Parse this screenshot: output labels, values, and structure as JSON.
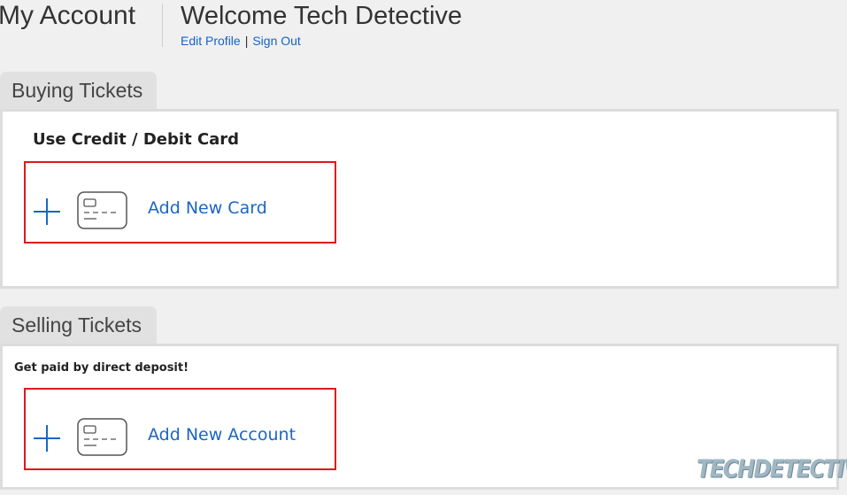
{
  "header": {
    "account_title": "My Account",
    "welcome_title": "Welcome Tech Detective",
    "edit_profile_link": "Edit Profile",
    "separator": "|",
    "sign_out_link": "Sign Out"
  },
  "buying": {
    "tab_label": "Buying Tickets",
    "heading": "Use Credit / Debit Card",
    "add_label": "Add New Card"
  },
  "selling": {
    "tab_label": "Selling Tickets",
    "heading": "Get paid by direct deposit!",
    "add_label": "Add New Account"
  },
  "icons": {
    "add": "plus-icon",
    "card": "credit-card-icon"
  },
  "colors": {
    "link": "#1464c8",
    "highlight_border": "#e01818",
    "action_text": "#1a66c4",
    "background": "#f0f0f0"
  },
  "watermark": "TECHDETECTIVE"
}
